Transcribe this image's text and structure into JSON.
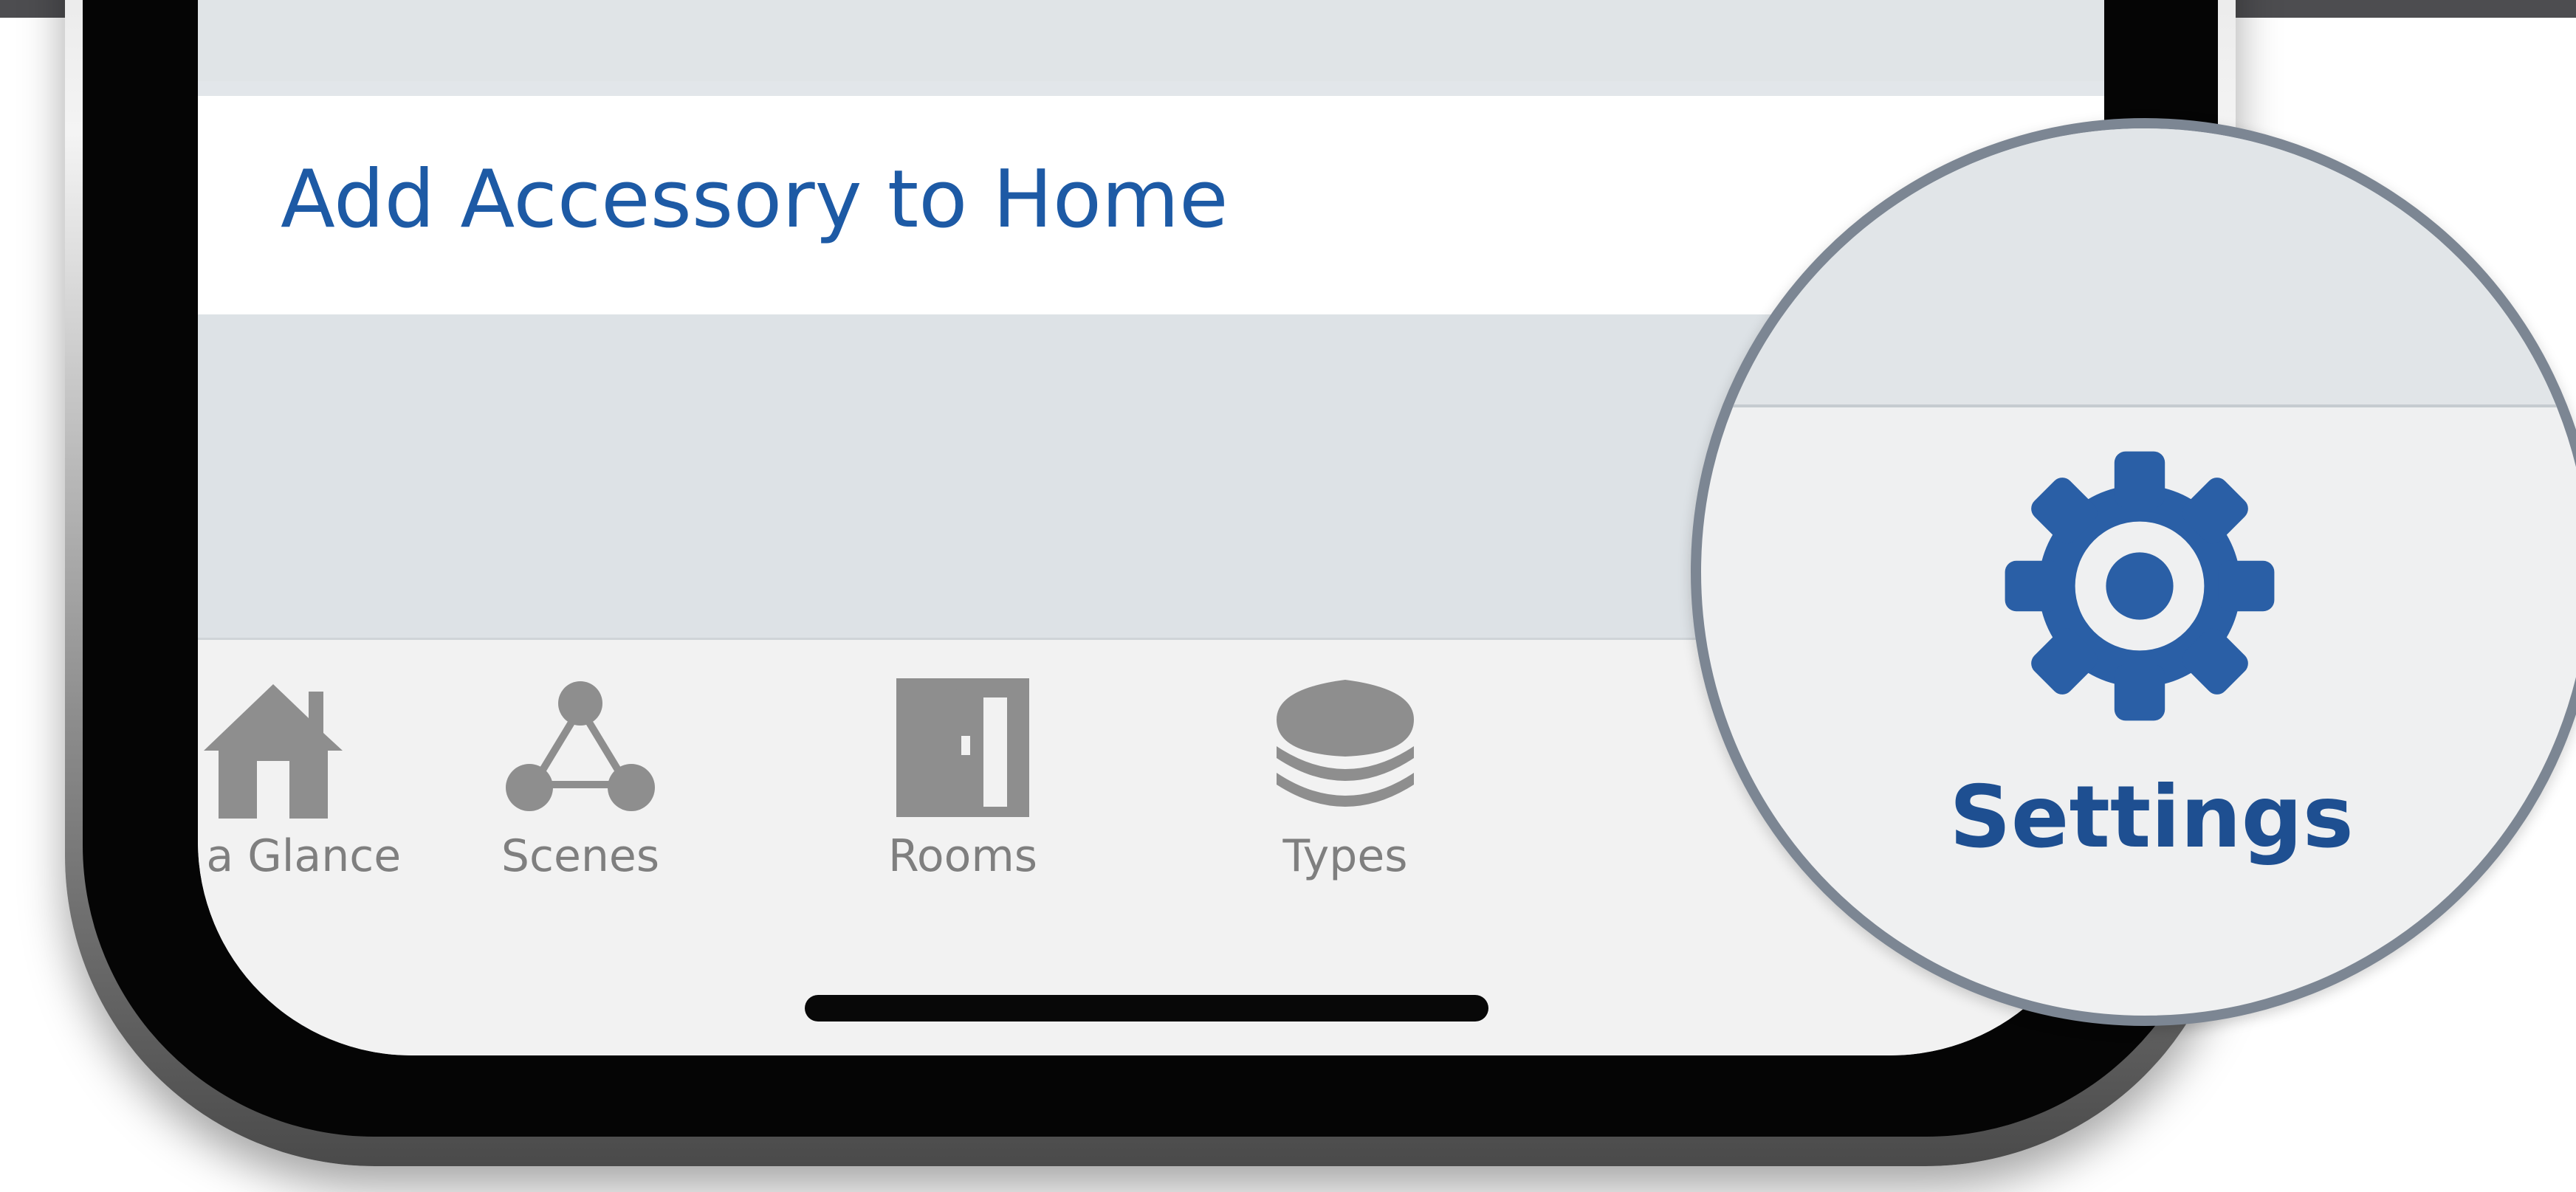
{
  "screen": {
    "add_accessory_label": "Add Accessory to Home"
  },
  "tab_bar": {
    "tabs": [
      {
        "label": "At a Glance",
        "icon": "house-icon"
      },
      {
        "label": "Scenes",
        "icon": "scenes-icon"
      },
      {
        "label": "Rooms",
        "icon": "door-icon"
      },
      {
        "label": "Types",
        "icon": "layers-icon"
      }
    ]
  },
  "magnifier": {
    "label": "Settings",
    "icon": "gear-icon"
  },
  "colors": {
    "link_blue": "#1d5aa5",
    "settings_blue": "#1e4f91",
    "tab_gray": "#7f7f7f"
  }
}
